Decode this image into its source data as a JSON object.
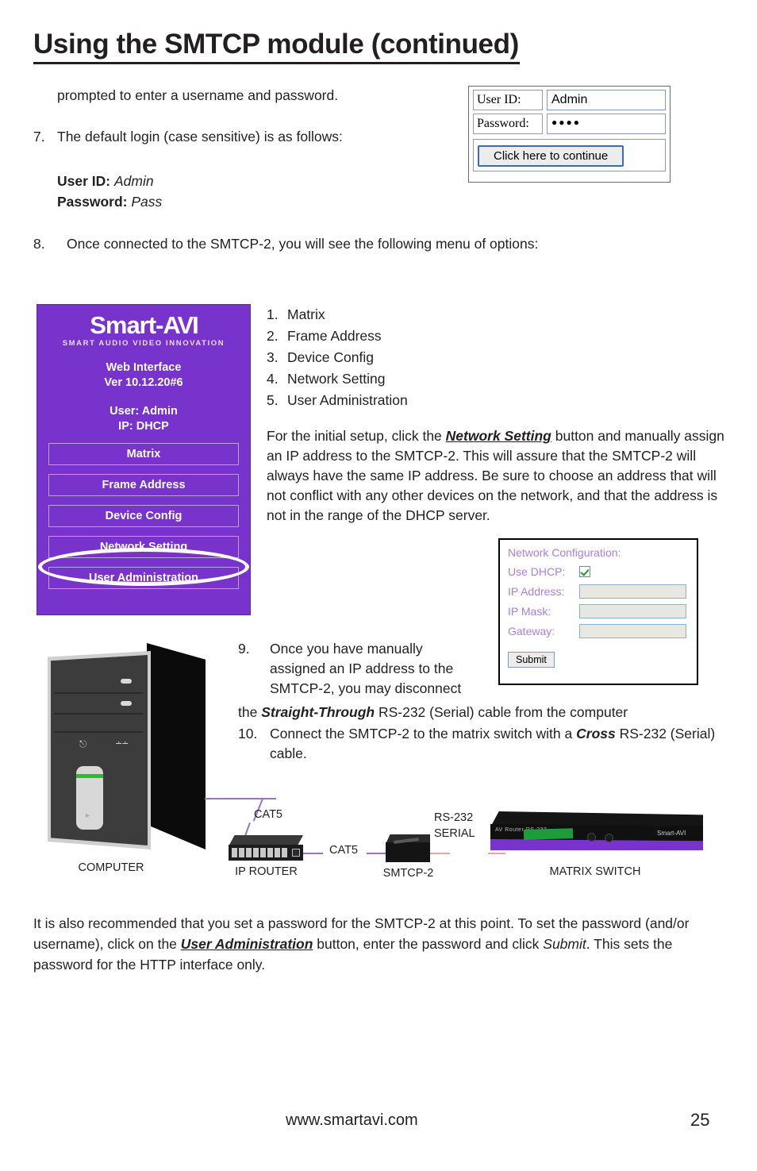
{
  "header": {
    "title": "Using the SMTCP module (continued)"
  },
  "body": {
    "prompted_line": "prompted to enter a username and password.",
    "step7": {
      "number": "7.",
      "text": "The default login (case sensitive) is as follows:"
    },
    "credentials": {
      "userid_label": "User ID:",
      "userid_value": "Admin",
      "password_label": "Password:",
      "password_value": "Pass"
    },
    "step8": {
      "number": "8.",
      "text": "Once connected to the SMTCP-2, you will see the following menu of options:"
    },
    "options": [
      {
        "number": "1.",
        "label": "Matrix"
      },
      {
        "number": "2.",
        "label": "Frame Address"
      },
      {
        "number": "3.",
        "label": "Device Config"
      },
      {
        "number": "4.",
        "label": "Network Setting"
      },
      {
        "number": "5.",
        "label": "User Administration"
      }
    ],
    "setup_paragraph": {
      "part1": "For the initial setup, click the ",
      "emphasis": "Network Setting",
      "part2": " button and manually assign an IP address to the SMTCP-2. This will assure that the SMTCP-2 will always have the same IP address. Be sure to choose an address that will not conflict with any other devices on the network, and that the address is not in the range of the DHCP server."
    },
    "step9": {
      "number": "9.",
      "text": "Once you have manually assigned an IP address to the SMTCP-2, you may disconnect"
    },
    "step9_continued": {
      "prefix": "the ",
      "emphasis": "Straight-Through",
      "suffix": " RS-232 (Serial) cable from the computer"
    },
    "step10": {
      "number": "10.",
      "prefix": "Connect the SMTCP-2 to the matrix switch with a ",
      "emphasis": "Cross",
      "suffix": " RS-232 (Serial) cable."
    },
    "closing_paragraph": {
      "part1": "It is also recommended that you set a password for the SMTCP-2 at this point. To set the password (and/or username), click on the ",
      "emphasis": "User Administration",
      "part2": " button, enter the password and click ",
      "emphasis2": "Submit",
      "part3": ".  This sets the password for the HTTP interface only."
    }
  },
  "login_dialog": {
    "userid_label": "User ID:",
    "userid_value": "Admin",
    "password_label": "Password:",
    "password_value": "●●●●",
    "button_label": "Click here to continue"
  },
  "avi_panel": {
    "logo_main": "Smart-",
    "logo_mark": "AVI",
    "logo_sub": "SMART AUDIO VIDEO INNOVATION",
    "interface_label": "Web Interface",
    "version": "Ver 10.12.20#6",
    "user": "User: Admin",
    "ip": "IP: DHCP",
    "buttons": [
      "Matrix",
      "Frame Address",
      "Device Config",
      "Network Setting",
      "User Administration"
    ],
    "highlighted_button": "Network Setting",
    "background_color": "#7733cc"
  },
  "network_dialog": {
    "title": "Network Configuration:",
    "dhcp_label": "Use DHCP:",
    "dhcp_checked": true,
    "ip_address_label": "IP Address:",
    "ip_address_value": "",
    "ip_mask_label": "IP Mask:",
    "ip_mask_value": "",
    "gateway_label": "Gateway:",
    "gateway_value": "",
    "submit_label": "Submit",
    "label_color": "#a97fe0"
  },
  "diagram": {
    "computer_label": "COMPUTER",
    "router_label": "IP ROUTER",
    "smtcp_label": "SMTCP-2",
    "matrix_label": "MATRIX SWITCH",
    "cable_pc_router": "CAT5",
    "cable_router_smtcp": "CAT5",
    "cable_smtcp_matrix_line1": "RS-232",
    "cable_smtcp_matrix_line2": "SERIAL",
    "matrix_brand": "Smart-AVI",
    "matrix_panel_text": "AV Router RS-232",
    "cat5_color": "#9b72c9",
    "serial_color": "#e8a5a5"
  },
  "footer": {
    "url": "www.smartavi.com",
    "page_number": "25"
  }
}
